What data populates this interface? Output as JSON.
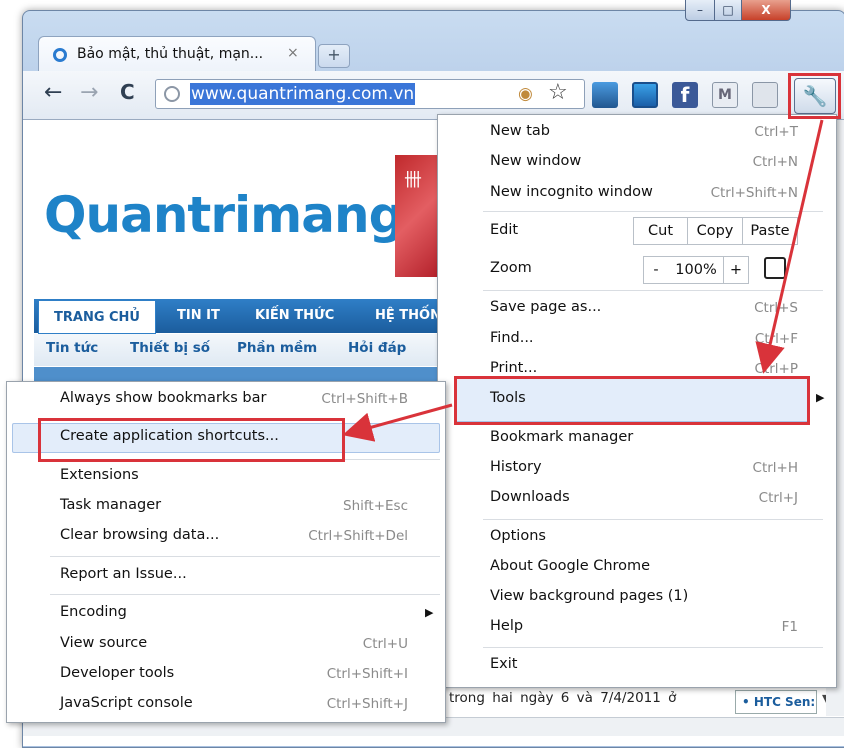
{
  "window": {
    "tab_title": "Bảo mật, thủ thuật, mạn...",
    "tab_close": "×",
    "new_tab": "+",
    "caption": {
      "minimize": "–",
      "maximize": "□",
      "close": "X"
    }
  },
  "toolbar": {
    "back": "←",
    "forward": "→",
    "reload": "C",
    "url": "www.quantrimang.com.vn",
    "star": "☆",
    "ext_facebook": "f",
    "ext_mail": "M",
    "wrench": "🔧"
  },
  "site": {
    "logo": "Quantrimang",
    "banner_mark": "卌",
    "nav_tabs": [
      "TRANG CHỦ",
      "TIN IT",
      "KIẾN THỨC",
      "HỆ THỐN"
    ],
    "sub_nav": [
      "Tin tức",
      "Thiết bị số",
      "Phần mềm",
      "Hỏi đáp"
    ],
    "status_text": "trong hai ngày 6 và 7/4/2011 ở",
    "htc_box": "• HTC Sen:"
  },
  "main_menu": {
    "new_tab": {
      "label": "New tab",
      "shortcut": "Ctrl+T"
    },
    "new_window": {
      "label": "New window",
      "shortcut": "Ctrl+N"
    },
    "new_incognito": {
      "label": "New incognito window",
      "shortcut": "Ctrl+Shift+N"
    },
    "edit": {
      "label": "Edit",
      "cut": "Cut",
      "copy": "Copy",
      "paste": "Paste"
    },
    "zoom": {
      "label": "Zoom",
      "minus": "-",
      "value": "100%",
      "plus": "+"
    },
    "save_page": {
      "label": "Save page as...",
      "shortcut": "Ctrl+S"
    },
    "find": {
      "label": "Find...",
      "shortcut": "Ctrl+F"
    },
    "print": {
      "label": "Print...",
      "shortcut": "Ctrl+P"
    },
    "tools": {
      "label": "Tools"
    },
    "bookmark_manager": {
      "label": "Bookmark manager"
    },
    "history": {
      "label": "History",
      "shortcut": "Ctrl+H"
    },
    "downloads": {
      "label": "Downloads",
      "shortcut": "Ctrl+J"
    },
    "options": {
      "label": "Options"
    },
    "about": {
      "label": "About Google Chrome"
    },
    "background_pages": {
      "label": "View background pages (1)"
    },
    "help": {
      "label": "Help",
      "shortcut": "F1"
    },
    "exit": {
      "label": "Exit"
    }
  },
  "tools_menu": {
    "bookmarks_bar": {
      "label": "Always show bookmarks bar",
      "shortcut": "Ctrl+Shift+B"
    },
    "create_shortcuts": {
      "label": "Create application shortcuts..."
    },
    "extensions": {
      "label": "Extensions"
    },
    "task_manager": {
      "label": "Task manager",
      "shortcut": "Shift+Esc"
    },
    "clear_data": {
      "label": "Clear browsing data...",
      "shortcut": "Ctrl+Shift+Del"
    },
    "report_issue": {
      "label": "Report an Issue..."
    },
    "encoding": {
      "label": "Encoding"
    },
    "view_source": {
      "label": "View source",
      "shortcut": "Ctrl+U"
    },
    "developer_tools": {
      "label": "Developer tools",
      "shortcut": "Ctrl+Shift+I"
    },
    "js_console": {
      "label": "JavaScript console",
      "shortcut": "Ctrl+Shift+J"
    }
  },
  "colors": {
    "annotation_red": "#d9333a",
    "highlight": "#e3edfa",
    "link_blue": "#1b5d9d"
  }
}
